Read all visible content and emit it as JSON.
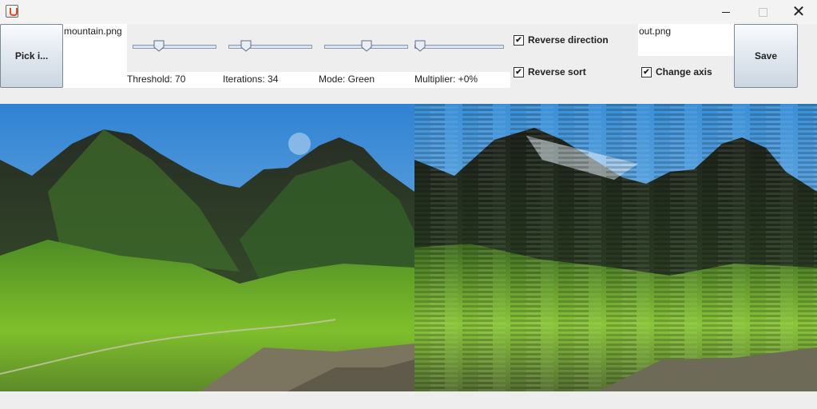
{
  "window": {
    "close_glyph": "✕"
  },
  "toolbar": {
    "pick_label": "Pick i...",
    "input_file": "mountain.png",
    "output_file": "out.png",
    "save_label": "Save"
  },
  "sliders": [
    {
      "label": "Threshold: 70",
      "level": 0.29
    },
    {
      "label": "Iterations: 34",
      "level": 0.17
    },
    {
      "label": "Mode: Green",
      "level": 0.5
    },
    {
      "label": "Multiplier: +0%",
      "level": 0.0
    }
  ],
  "options": {
    "reverse_direction": {
      "label": "Reverse direction",
      "checked": true
    },
    "reverse_sort": {
      "label": "Reverse sort",
      "checked": true
    },
    "change_axis": {
      "label": "Change axis",
      "checked": true
    }
  },
  "check_glyph": "✔",
  "icons": [
    "java-app-icon",
    "minimize-icon",
    "maximize-icon",
    "close-icon",
    "checkmark-icon"
  ],
  "colors": {
    "sky": "#3c8fd8",
    "grass": "#6fae2a",
    "mountain": "#2e3d2a",
    "button_border": "#7a8a99"
  }
}
